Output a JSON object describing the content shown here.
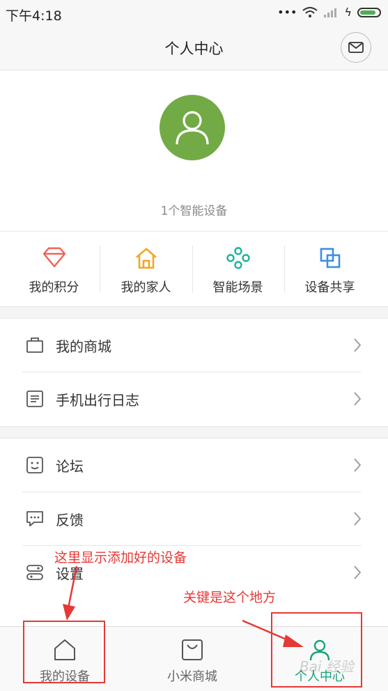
{
  "status": {
    "time": "下午4:18"
  },
  "header": {
    "title": "个人中心"
  },
  "profile": {
    "device_count": "1个智能设备"
  },
  "quick_actions": [
    {
      "label": "我的积分",
      "icon": "diamond-icon",
      "color": "#f0625a"
    },
    {
      "label": "我的家人",
      "icon": "home-icon",
      "color": "#f5a623"
    },
    {
      "label": "智能场景",
      "icon": "scene-icon",
      "color": "#1cb29a"
    },
    {
      "label": "设备共享",
      "icon": "share-icon",
      "color": "#3d8fe0"
    }
  ],
  "menu_group1": [
    {
      "label": "我的商城",
      "icon": "shop-bag-icon"
    },
    {
      "label": "手机出行日志",
      "icon": "log-icon"
    }
  ],
  "menu_group2": [
    {
      "label": "论坛",
      "icon": "forum-icon"
    },
    {
      "label": "反馈",
      "icon": "feedback-icon"
    },
    {
      "label": "设置",
      "icon": "settings-icon"
    }
  ],
  "tabs": [
    {
      "label": "我的设备",
      "icon": "home-outline-icon",
      "active": false
    },
    {
      "label": "小米商城",
      "icon": "bag-outline-icon",
      "active": false
    },
    {
      "label": "个人中心",
      "icon": "person-icon",
      "active": true
    }
  ],
  "annotations": {
    "note_devices": "这里显示添加好的设备",
    "note_key": "关键是这个地方",
    "color": "#e53935"
  },
  "accent_color": "#17a37a",
  "watermark": "Bai 经验"
}
